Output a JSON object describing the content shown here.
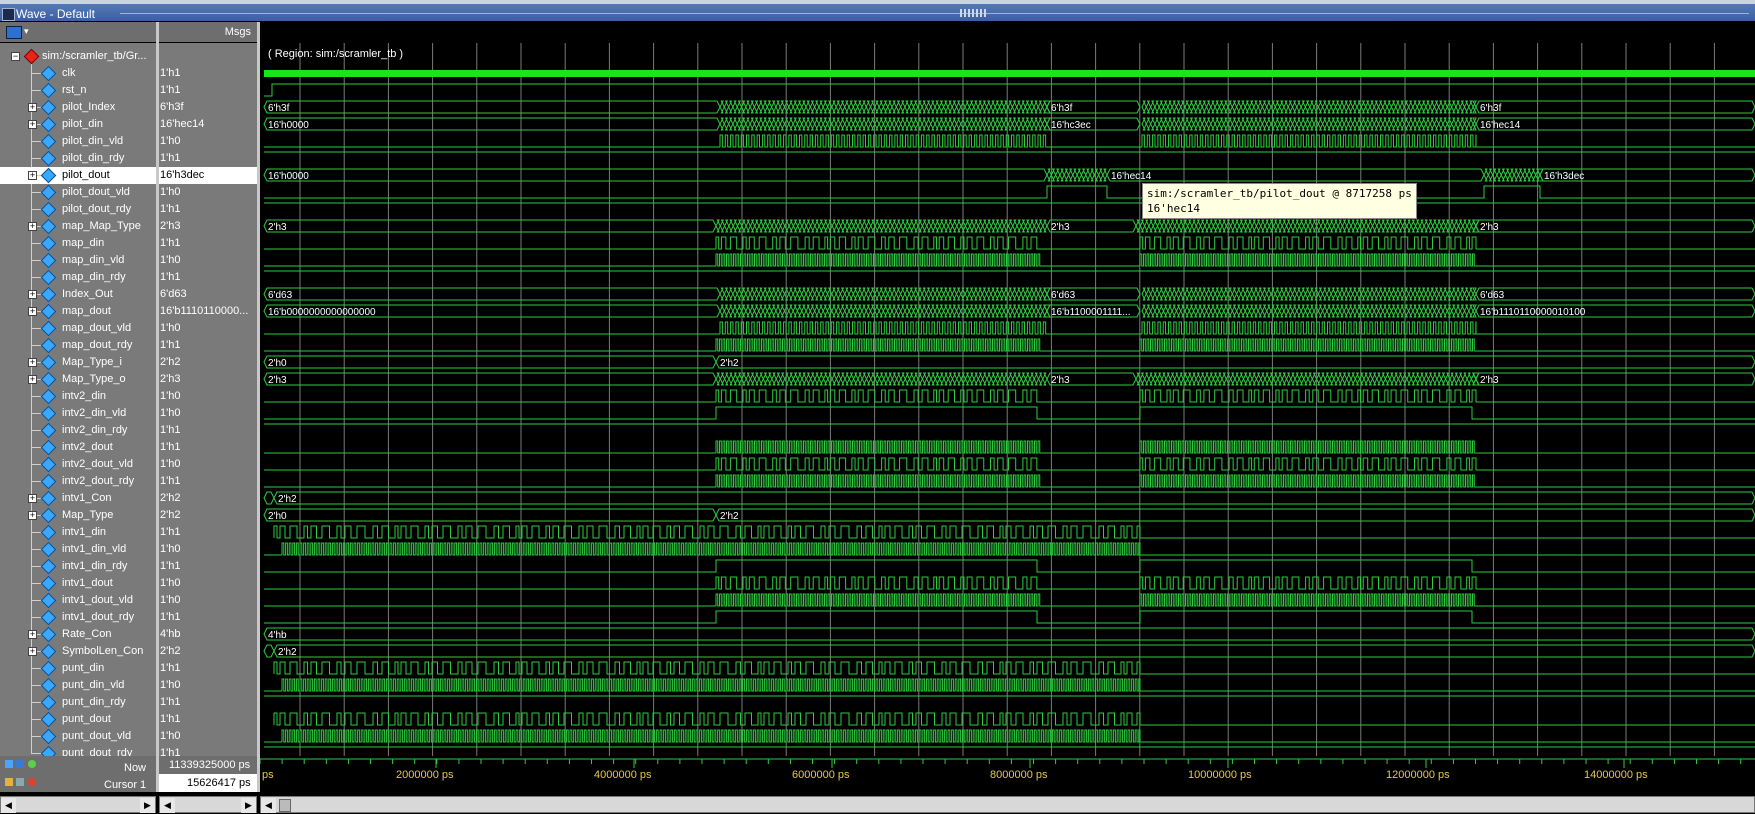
{
  "window": {
    "title": "Wave - Default"
  },
  "header": {
    "msgs_label": "Msgs"
  },
  "region_label": "( Region: sim:/scramler_tb )",
  "tooltip": {
    "line1": "sim:/scramler_tb/pilot_dout @ 8717258 ps",
    "line2": "16'hec14"
  },
  "status": {
    "now_label": "Now",
    "now_value": "11339325000 ps",
    "cursor_label": "Cursor 1",
    "cursor_value": "15626417 ps"
  },
  "timeline": {
    "left_cut": "ps",
    "ticks": [
      "2000000 ps",
      "4000000 ps",
      "6000000 ps",
      "8000000 ps",
      "10000000 ps",
      "12000000 ps",
      "14000000 ps"
    ]
  },
  "signals": [
    {
      "name": "sim:/scramler_tb/Gr...",
      "value": "",
      "group": true,
      "expand": true
    },
    {
      "name": "clk",
      "value": "1'h1",
      "type": "clk"
    },
    {
      "name": "rst_n",
      "value": "1'h1",
      "type": "rst"
    },
    {
      "name": "pilot_Index",
      "value": "6'h3f",
      "expand": true,
      "type": "bus",
      "segs": [
        [
          "6'h3f"
        ],
        [
          "6'h3f"
        ],
        [
          "6'h3f"
        ]
      ]
    },
    {
      "name": "pilot_din",
      "value": "16'hec14",
      "expand": true,
      "type": "bus",
      "segs": [
        [
          "16'h0000"
        ],
        [
          "16'hc3ec"
        ],
        [
          "16'hec14"
        ]
      ]
    },
    {
      "name": "pilot_din_vld",
      "value": "1'h0",
      "type": "pulse2"
    },
    {
      "name": "pilot_din_rdy",
      "value": "1'h1",
      "type": "high"
    },
    {
      "name": "pilot_dout",
      "value": "16'h3dec",
      "expand": true,
      "type": "pdout",
      "selected": true,
      "segs": [
        [
          "16'h0000"
        ],
        [
          "16'hec14"
        ],
        [
          "16'h3dec"
        ]
      ]
    },
    {
      "name": "pilot_dout_vld",
      "value": "1'h0",
      "type": "pvld"
    },
    {
      "name": "pilot_dout_rdy",
      "value": "1'h1",
      "type": "high"
    },
    {
      "name": "map_Map_Type",
      "value": "2'h3",
      "expand": true,
      "type": "busdense",
      "segs": [
        [
          "2'h3"
        ],
        [
          "2'h3"
        ],
        [
          "2'h3"
        ]
      ]
    },
    {
      "name": "map_din",
      "value": "1'h1",
      "type": "rand"
    },
    {
      "name": "map_din_vld",
      "value": "1'h0",
      "type": "dense"
    },
    {
      "name": "map_din_rdy",
      "value": "1'h1",
      "type": "high"
    },
    {
      "name": "Index_Out",
      "value": "6'd63",
      "expand": true,
      "type": "bus",
      "segs": [
        [
          "6'd63"
        ],
        [
          "6'd63"
        ],
        [
          "6'd63"
        ]
      ]
    },
    {
      "name": "map_dout",
      "value": "16'b1110110000...",
      "expand": true,
      "type": "bus",
      "segs": [
        [
          "16'b0000000000000000"
        ],
        [
          "16'b1100001111..."
        ],
        [
          "16'b1110110000010100"
        ]
      ]
    },
    {
      "name": "map_dout_vld",
      "value": "1'h0",
      "type": "pulse2"
    },
    {
      "name": "map_dout_rdy",
      "value": "1'h1",
      "type": "dense"
    },
    {
      "name": "Map_Type_i",
      "value": "2'h2",
      "expand": true,
      "type": "bus1",
      "segs": [
        [
          "2'h0"
        ],
        [
          "2'h2"
        ]
      ]
    },
    {
      "name": "Map_Type_o",
      "value": "2'h3",
      "expand": true,
      "type": "busdense",
      "segs": [
        [
          "2'h3"
        ],
        [
          "2'h3"
        ],
        [
          "2'h3"
        ]
      ]
    },
    {
      "name": "intv2_din",
      "value": "1'h0",
      "type": "rand"
    },
    {
      "name": "intv2_din_vld",
      "value": "1'h0",
      "type": "win"
    },
    {
      "name": "intv2_din_rdy",
      "value": "1'h1",
      "type": "high"
    },
    {
      "name": "intv2_dout",
      "value": "1'h1",
      "type": "dense"
    },
    {
      "name": "intv2_dout_vld",
      "value": "1'h0",
      "type": "rand"
    },
    {
      "name": "intv2_dout_rdy",
      "value": "1'h1",
      "type": "dense"
    },
    {
      "name": "intv1_Con",
      "value": "2'h2",
      "expand": true,
      "type": "busstart",
      "segs": [
        [
          "2'h2"
        ]
      ]
    },
    {
      "name": "Map_Type",
      "value": "2'h2",
      "expand": true,
      "type": "bus1",
      "segs": [
        [
          "2'h0"
        ],
        [
          "2'h2"
        ]
      ]
    },
    {
      "name": "intv1_din",
      "value": "1'h1",
      "type": "early"
    },
    {
      "name": "intv1_din_vld",
      "value": "1'h0",
      "type": "earlydense"
    },
    {
      "name": "intv1_din_rdy",
      "value": "1'h1",
      "type": "win"
    },
    {
      "name": "intv1_dout",
      "value": "1'h0",
      "type": "rand"
    },
    {
      "name": "intv1_dout_vld",
      "value": "1'h0",
      "type": "dense"
    },
    {
      "name": "intv1_dout_rdy",
      "value": "1'h1",
      "type": "win"
    },
    {
      "name": "Rate_Con",
      "value": "4'hb",
      "expand": true,
      "type": "busonly",
      "segs": [
        [
          "4'hb"
        ]
      ]
    },
    {
      "name": "SymbolLen_Con",
      "value": "2'h2",
      "expand": true,
      "type": "busstart",
      "segs": [
        [
          "2'h2"
        ]
      ]
    },
    {
      "name": "punt_din",
      "value": "1'h1",
      "type": "early"
    },
    {
      "name": "punt_din_vld",
      "value": "1'h0",
      "type": "earlydense"
    },
    {
      "name": "punt_din_rdy",
      "value": "1'h1",
      "type": "high"
    },
    {
      "name": "punt_dout",
      "value": "1'h1",
      "type": "early"
    },
    {
      "name": "punt_dout_vld",
      "value": "1'h0",
      "type": "earlydense"
    },
    {
      "name": "punt_dout_rdy",
      "value": "1'h1",
      "type": "high"
    }
  ]
}
